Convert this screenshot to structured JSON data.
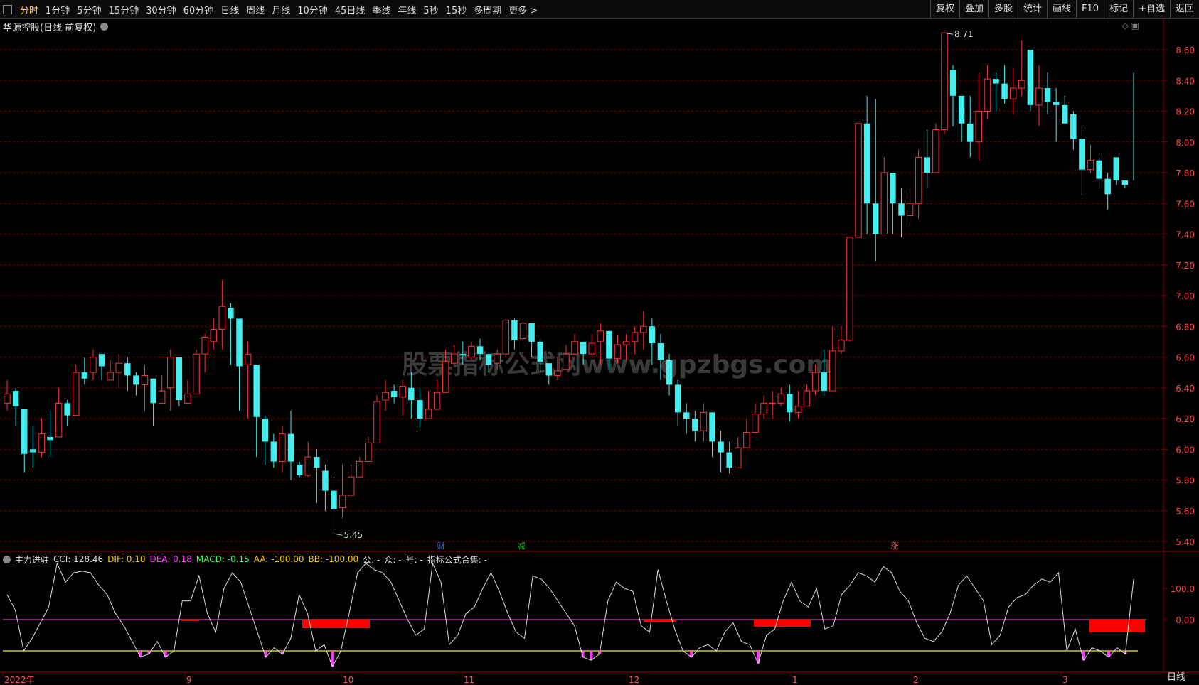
{
  "toolbar": {
    "periods": [
      "分时",
      "1分钟",
      "5分钟",
      "15分钟",
      "30分钟",
      "60分钟",
      "日线",
      "周线",
      "月线",
      "10分钟",
      "45日线",
      "季线",
      "年线",
      "5秒",
      "15秒",
      "多周期",
      "更多 >"
    ],
    "active": "分时",
    "right": [
      "复权",
      "叠加",
      "多股",
      "统计",
      "画线",
      "F10",
      "标记",
      "+自选",
      "返回"
    ]
  },
  "stock": {
    "title": "华源控股(日线 前复权)"
  },
  "indicator": {
    "name": "主力进驻",
    "cci": "CCI: 128.46",
    "dif": "DIF: 0.10",
    "dea": "DEA: 0.18",
    "macd": "MACD: -0.15",
    "aa": "AA: -100.00",
    "bb": "BB: -100.00",
    "gong": "公: -",
    "zhong": "众: -",
    "hao": "号: -",
    "formula": "指标公式合集: -"
  },
  "status_label": "日线",
  "watermark": "股票指标公式网www.gpzbgs.com",
  "event_markers": [
    "财",
    "减",
    "涨"
  ],
  "colors": {
    "up": "#ff3333",
    "down": "#44eeee",
    "grid": "#6b0000",
    "cci": "#dddddd",
    "magenta": "#ff33ff",
    "yellow": "#cccc00"
  },
  "chart_data": [
    {
      "type": "candlestick",
      "ylim": [
        5.4,
        8.6
      ],
      "y_ticks": [
        "8.60",
        "8.40",
        "8.20",
        "8.00",
        "7.80",
        "7.60",
        "7.40",
        "7.20",
        "7.00",
        "6.80",
        "6.60",
        "6.40",
        "6.20",
        "6.00",
        "5.80",
        "5.60",
        "5.40"
      ],
      "x_labels": [
        "2022年",
        "9",
        "10",
        "11",
        "12",
        "1",
        "2",
        "3"
      ],
      "max_label": "8.71",
      "min_label": "5.45",
      "closes": [
        6.36,
        6.28,
        5.97,
        5.98,
        6.1,
        6.06,
        6.3,
        6.22,
        6.5,
        6.46,
        6.6,
        6.54,
        6.5,
        6.56,
        6.48,
        6.42,
        6.48,
        6.3,
        6.38,
        6.6,
        6.32,
        6.36,
        6.62,
        6.73,
        6.78,
        6.93,
        6.85,
        6.54,
        6.62,
        6.21,
        6.05,
        5.92,
        6.1,
        5.92,
        5.83,
        5.95,
        5.88,
        5.73,
        5.61,
        5.7,
        5.82,
        5.92,
        6.04,
        6.31,
        6.37,
        6.34,
        6.41,
        6.32,
        6.2,
        6.26,
        6.37,
        6.57,
        6.62,
        6.61,
        6.67,
        6.62,
        6.55,
        6.62,
        6.84,
        6.71,
        6.82,
        6.7,
        6.57,
        6.48,
        6.51,
        6.62,
        6.7,
        6.62,
        6.69,
        6.77,
        6.59,
        6.68,
        6.7,
        6.76,
        6.8,
        6.69,
        6.58,
        6.42,
        6.24,
        6.2,
        6.12,
        6.24,
        6.05,
        5.98,
        5.88,
        6.01,
        6.11,
        6.23,
        6.3,
        6.3,
        6.36,
        6.24,
        6.28,
        6.38,
        6.5,
        6.38,
        6.64,
        6.71,
        7.38,
        8.12,
        7.6,
        7.4,
        7.8,
        7.6,
        7.52,
        7.6,
        7.9,
        7.8,
        8.08,
        8.71,
        8.3,
        8.12,
        8.0,
        8.2,
        8.41,
        8.38,
        8.28,
        8.35,
        8.4,
        8.24,
        8.35,
        8.26,
        8.24,
        8.12,
        8.02,
        7.82,
        7.88,
        7.76,
        7.66,
        7.75,
        7.72,
        8.45
      ],
      "highs": [
        6.45,
        6.4,
        6.2,
        6.15,
        6.2,
        6.25,
        6.4,
        6.32,
        6.55,
        6.6,
        6.65,
        6.6,
        6.58,
        6.62,
        6.6,
        6.5,
        6.55,
        6.45,
        6.48,
        6.65,
        6.55,
        6.45,
        6.65,
        6.75,
        6.85,
        7.1,
        6.95,
        6.8,
        6.7,
        6.55,
        6.22,
        6.1,
        6.15,
        6.25,
        5.92,
        6.05,
        6.0,
        5.9,
        5.82,
        5.9,
        5.9,
        5.95,
        6.08,
        6.35,
        6.45,
        6.42,
        6.45,
        6.5,
        6.4,
        6.38,
        6.45,
        6.65,
        6.68,
        6.7,
        6.7,
        6.72,
        6.62,
        6.65,
        6.85,
        6.85,
        6.85,
        6.78,
        6.72,
        6.55,
        6.6,
        6.68,
        6.75,
        6.68,
        6.75,
        6.82,
        6.75,
        6.74,
        6.75,
        6.8,
        6.9,
        6.85,
        6.75,
        6.62,
        6.45,
        6.3,
        6.25,
        6.3,
        6.2,
        6.12,
        6.05,
        6.08,
        6.2,
        6.3,
        6.35,
        6.38,
        6.4,
        6.42,
        6.38,
        6.42,
        6.55,
        6.65,
        6.8,
        6.8,
        7.38,
        8.12,
        8.3,
        8.28,
        7.9,
        7.7,
        7.7,
        7.7,
        7.95,
        8.08,
        8.12,
        8.71,
        8.5,
        8.2,
        8.3,
        8.45,
        8.5,
        8.45,
        8.5,
        8.48,
        8.66,
        8.55,
        8.5,
        8.45,
        8.35,
        8.3,
        8.2,
        8.1,
        7.98,
        7.9,
        7.8,
        7.8,
        7.72,
        8.45
      ],
      "lows": [
        6.25,
        6.15,
        5.85,
        5.88,
        5.95,
        5.95,
        6.1,
        6.15,
        6.35,
        6.42,
        6.45,
        6.45,
        6.45,
        6.4,
        6.38,
        6.35,
        6.25,
        6.15,
        6.32,
        6.25,
        6.28,
        6.3,
        6.48,
        6.5,
        6.65,
        6.65,
        6.55,
        6.25,
        6.2,
        5.95,
        5.9,
        5.88,
        5.85,
        5.8,
        5.82,
        5.82,
        5.65,
        5.6,
        5.45,
        5.55,
        5.72,
        5.84,
        5.95,
        6.1,
        6.25,
        6.3,
        6.22,
        6.2,
        6.14,
        6.2,
        6.28,
        6.5,
        6.55,
        6.55,
        6.58,
        6.58,
        6.5,
        6.52,
        6.6,
        6.65,
        6.62,
        6.6,
        6.5,
        6.42,
        6.45,
        6.52,
        6.62,
        6.55,
        6.6,
        6.55,
        6.52,
        6.56,
        6.58,
        6.62,
        6.65,
        6.55,
        6.45,
        6.35,
        6.15,
        6.1,
        6.05,
        6.05,
        5.95,
        5.85,
        5.84,
        5.9,
        6.05,
        6.15,
        6.2,
        6.2,
        6.28,
        6.18,
        6.2,
        6.28,
        6.35,
        6.35,
        6.4,
        6.62,
        6.7,
        7.4,
        7.4,
        7.22,
        7.4,
        7.4,
        7.38,
        7.45,
        7.5,
        7.7,
        7.8,
        8.05,
        8.1,
        8.0,
        7.9,
        7.88,
        8.15,
        8.2,
        8.25,
        8.18,
        8.3,
        8.2,
        8.1,
        8.18,
        8.0,
        8.12,
        7.95,
        7.65,
        7.8,
        7.7,
        7.56,
        7.72,
        7.7,
        7.75
      ],
      "opens": [
        6.3,
        6.38,
        6.26,
        6.0,
        5.98,
        6.08,
        6.08,
        6.3,
        6.22,
        6.5,
        6.5,
        6.62,
        6.45,
        6.5,
        6.56,
        6.48,
        6.42,
        6.46,
        6.3,
        6.4,
        6.6,
        6.3,
        6.36,
        6.62,
        6.7,
        6.78,
        6.92,
        6.85,
        6.55,
        6.55,
        6.2,
        6.05,
        5.92,
        6.1,
        5.9,
        5.83,
        5.95,
        5.86,
        5.73,
        5.62,
        5.7,
        5.82,
        5.92,
        6.04,
        6.32,
        6.38,
        6.34,
        6.4,
        6.32,
        6.2,
        6.26,
        6.37,
        6.56,
        6.62,
        6.6,
        6.67,
        6.62,
        6.56,
        6.62,
        6.84,
        6.72,
        6.82,
        6.7,
        6.56,
        6.48,
        6.52,
        6.62,
        6.7,
        6.62,
        6.7,
        6.77,
        6.59,
        6.68,
        6.7,
        6.76,
        6.8,
        6.69,
        6.58,
        6.42,
        6.24,
        6.2,
        6.12,
        6.24,
        6.05,
        5.98,
        5.88,
        6.01,
        6.11,
        6.23,
        6.3,
        6.3,
        6.36,
        6.24,
        6.28,
        6.38,
        6.5,
        6.38,
        6.64,
        6.71,
        7.38,
        8.12,
        7.6,
        7.4,
        7.8,
        7.6,
        7.52,
        7.6,
        7.9,
        7.8,
        8.08,
        8.47,
        8.3,
        8.12,
        8.0,
        8.2,
        8.41,
        8.38,
        8.28,
        8.35,
        8.6,
        8.24,
        8.35,
        8.26,
        8.24,
        8.18,
        8.02,
        7.82,
        7.88,
        7.76,
        7.9,
        7.75
      ]
    },
    {
      "type": "line",
      "name": "CCI",
      "ylim": [
        -200,
        200
      ],
      "y_ticks": [
        "100.0",
        "0.00"
      ],
      "values": [
        80,
        30,
        -100,
        -60,
        -10,
        40,
        180,
        120,
        150,
        155,
        150,
        110,
        80,
        20,
        -20,
        -70,
        -120,
        -110,
        -70,
        -120,
        -100,
        60,
        60,
        140,
        20,
        -40,
        100,
        150,
        120,
        40,
        -40,
        -120,
        -90,
        -110,
        -60,
        80,
        20,
        -100,
        -80,
        -150,
        -100,
        20,
        150,
        180,
        160,
        150,
        120,
        60,
        0,
        -50,
        -30,
        180,
        120,
        -80,
        -50,
        20,
        40,
        100,
        150,
        90,
        20,
        -40,
        -60,
        140,
        130,
        100,
        60,
        20,
        -20,
        -120,
        -130,
        -110,
        60,
        120,
        100,
        90,
        -20,
        -40,
        160,
        60,
        -30,
        -100,
        -120,
        -90,
        -80,
        -100,
        -40,
        -10,
        -70,
        -80,
        -140,
        -50,
        -30,
        60,
        120,
        60,
        40,
        100,
        -30,
        -20,
        80,
        110,
        150,
        140,
        120,
        170,
        150,
        90,
        60,
        -10,
        -60,
        -70,
        -40,
        20,
        110,
        140,
        100,
        60,
        -80,
        -50,
        40,
        70,
        80,
        110,
        130,
        120,
        150,
        -100,
        -30,
        -130,
        -90,
        -100,
        -120,
        -90,
        -110,
        130
      ],
      "neg_bars": [
        0,
        0,
        0,
        0,
        0,
        0,
        0,
        0,
        0,
        0,
        0,
        0,
        0,
        0,
        0,
        0,
        0,
        0,
        0,
        0,
        0,
        0,
        0,
        0,
        0,
        0,
        0,
        0,
        0,
        0,
        0,
        0,
        0,
        0,
        0,
        0,
        0,
        0,
        0,
        0,
        0,
        0,
        0,
        0,
        0,
        0,
        0,
        0,
        0,
        0,
        0,
        0,
        0,
        0,
        0,
        0,
        0,
        0,
        0,
        0,
        0,
        0,
        0,
        0,
        0,
        0,
        0,
        0,
        0,
        0,
        0,
        0,
        0,
        0,
        0,
        0,
        0,
        0,
        0,
        0,
        0,
        0,
        0,
        0,
        0,
        0,
        0,
        0,
        0,
        0,
        0,
        0,
        0,
        0,
        0,
        0,
        0,
        0,
        0,
        0,
        0,
        0,
        0,
        0,
        0,
        0,
        0,
        0,
        0,
        0,
        0,
        0,
        0,
        0,
        0,
        0,
        0,
        0,
        0,
        0,
        0,
        0,
        0,
        0,
        0,
        0,
        0,
        0,
        0,
        0,
        0,
        0,
        0,
        0
      ]
    }
  ]
}
